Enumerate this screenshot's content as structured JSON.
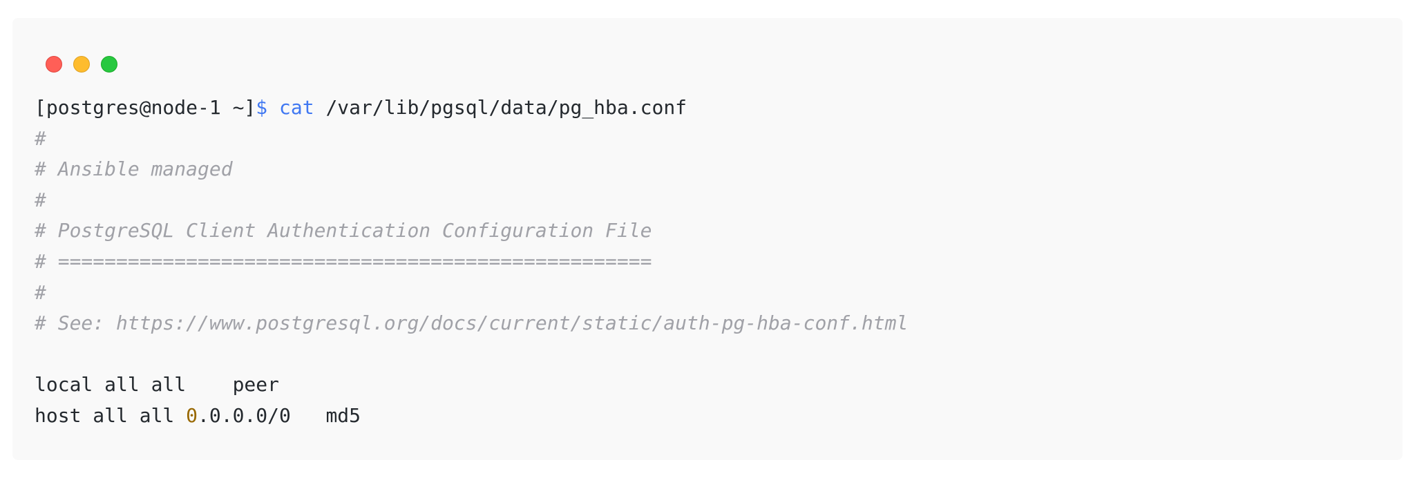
{
  "window": {
    "controls": [
      "close",
      "minimize",
      "maximize"
    ]
  },
  "terminal": {
    "prompt": "[postgres@node-1 ~]",
    "prompt_symbol": "$",
    "command": "cat",
    "argument": " /var/lib/pgsql/data/pg_hba.conf",
    "comments": [
      "#",
      "# Ansible managed",
      "#",
      "# PostgreSQL Client Authentication Configuration File",
      "# ===================================================",
      "#",
      "# See: https://www.postgresql.org/docs/current/static/auth-pg-hba-conf.html"
    ],
    "rule_local": "local all all    peer",
    "rule_host_prefix": "host all all ",
    "rule_host_highlight": "0",
    "rule_host_suffix": ".0.0.0/0   md5"
  },
  "colors": {
    "background": "#f9f9f9",
    "text": "#24292e",
    "comment": "#a0a1a7",
    "keyword": "#4078f2",
    "number": "#986801"
  }
}
